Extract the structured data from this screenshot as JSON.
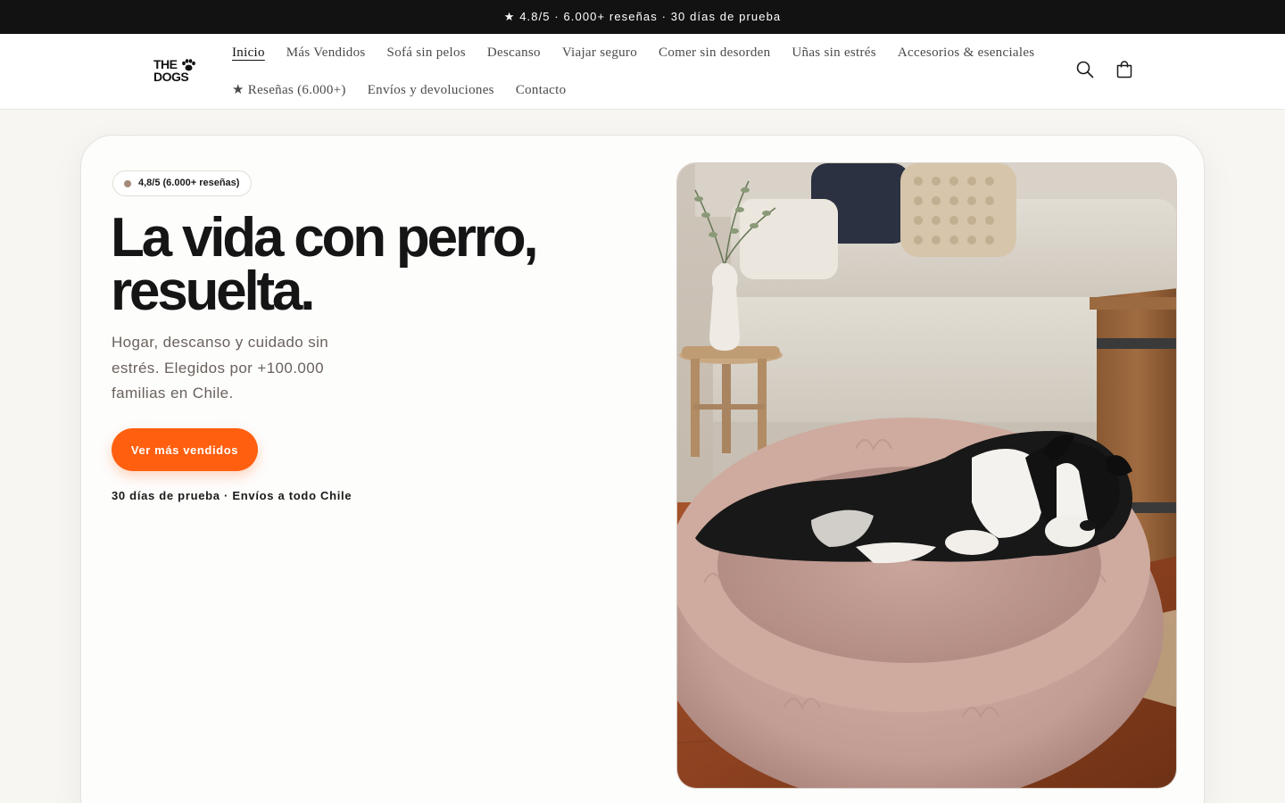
{
  "announcement": "★ 4.8/5 · 6.000+ reseñas · 30 días de prueba",
  "brand": {
    "line1": "THE",
    "line2": "DOGS"
  },
  "nav": {
    "row1": [
      "Inicio",
      "Más Vendidos",
      "Sofá sin pelos",
      "Descanso",
      "Viajar seguro",
      "Comer sin desorden",
      "Uñas sin estrés",
      "Accesorios & esenciales"
    ],
    "row2": [
      "★ Reseñas (6.000+)",
      "Envíos y devoluciones",
      "Contacto"
    ],
    "active": "Inicio"
  },
  "header_icons": [
    "search-icon",
    "cart-icon"
  ],
  "hero": {
    "rating_badge": "4,8/5 (6.000+ reseñas)",
    "headline_line1": "La vida con perro,",
    "headline_line2": "resuelta.",
    "subtext": "Hogar, descanso y cuidado sin estrés. Elegidos por +100.000 familias en Chile.",
    "cta_label": "Ver más vendidos",
    "trust_line": "30 días de prueba · Envíos a todo Chile",
    "image_subject": "Border collie sleeping in a pink fluffy round bed in a living room"
  },
  "colors": {
    "announcement_bg": "#121212",
    "accent": "#ff5f0f",
    "page_bg": "#f8f6f2",
    "rating_dot": "#a38a7a"
  }
}
